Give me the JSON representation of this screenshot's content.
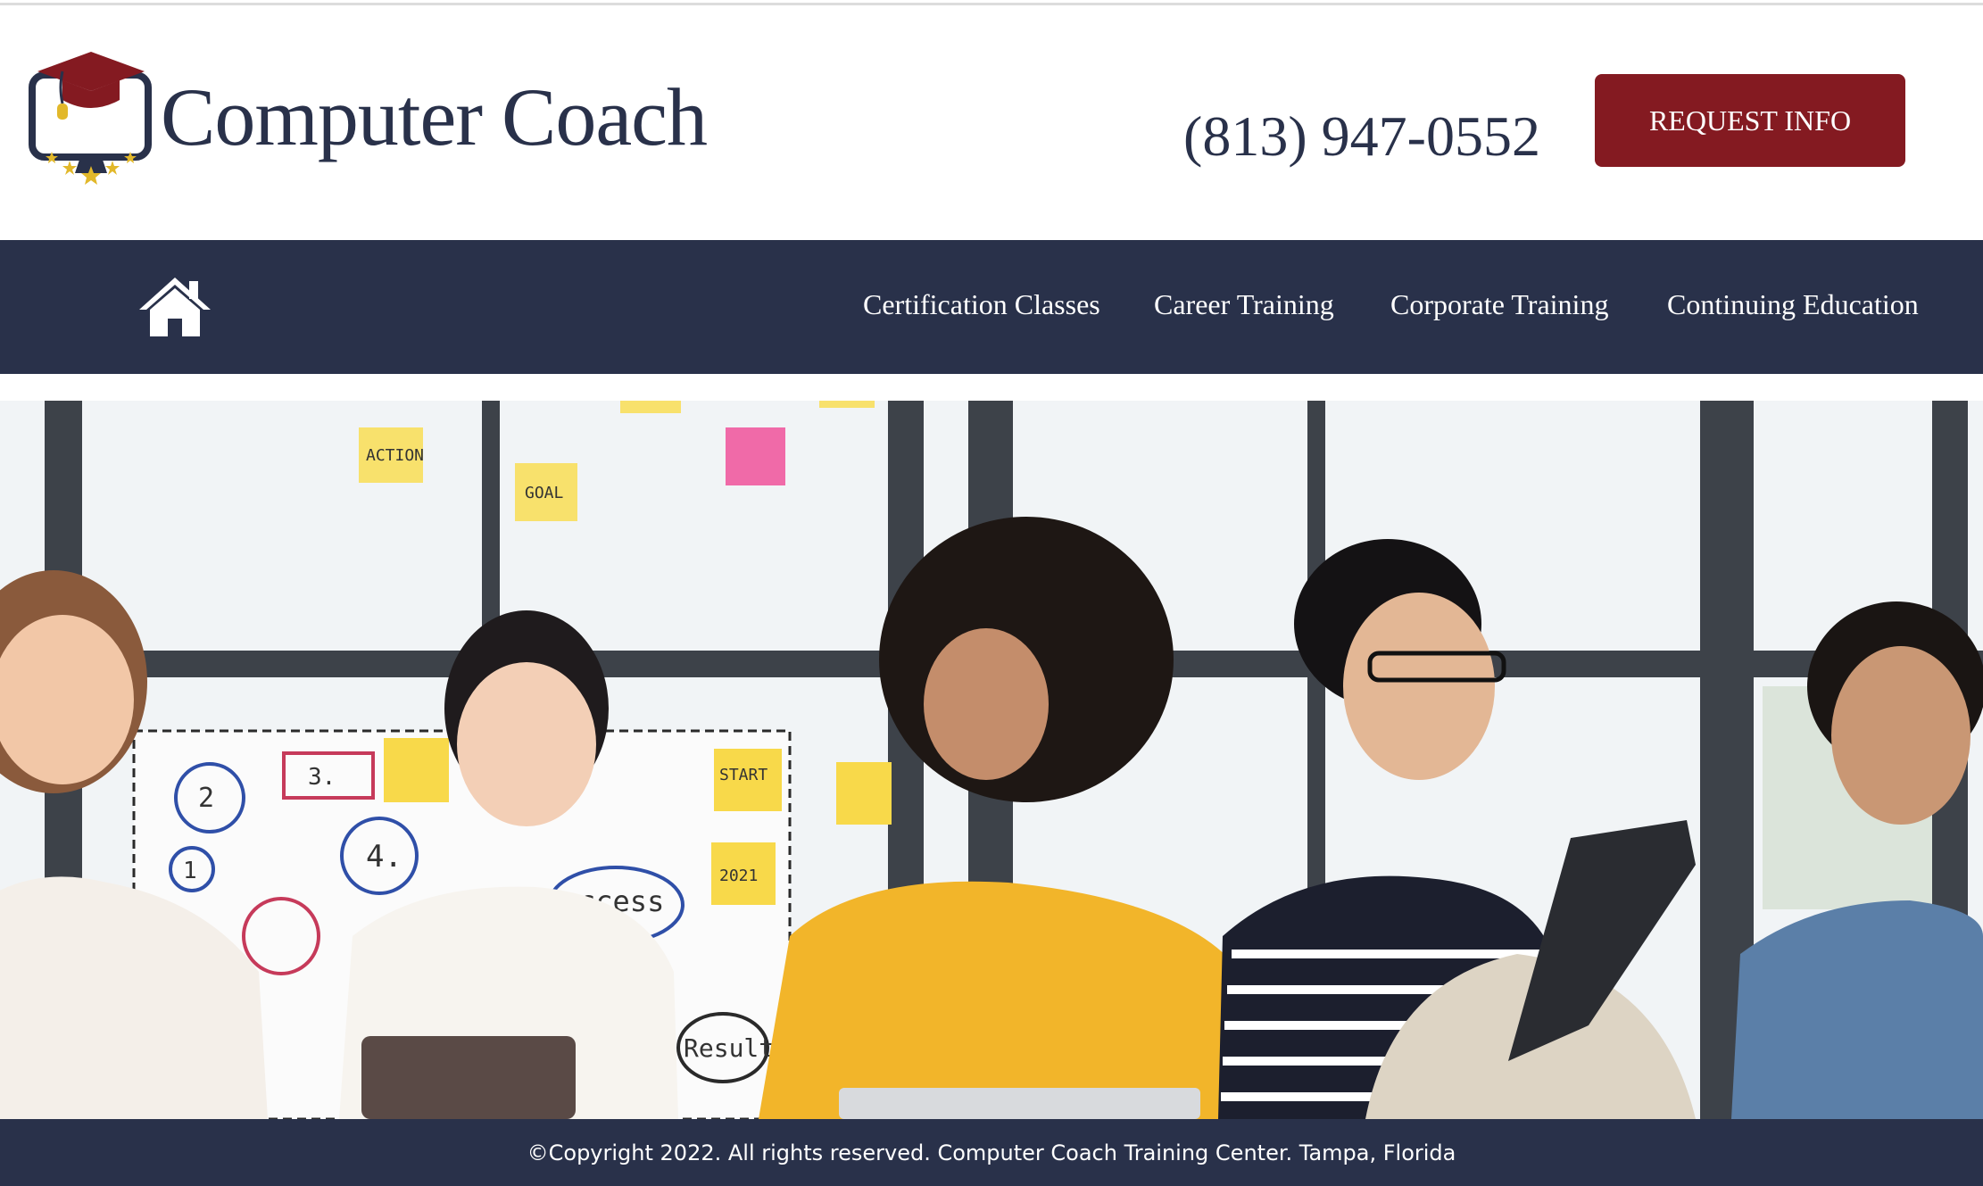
{
  "header": {
    "brand_name": "Computer Coach",
    "phone": "(813) 947-0552",
    "request_label": "REQUEST INFO"
  },
  "nav": {
    "home_icon": "home-icon",
    "items": [
      {
        "label": "Certification Classes"
      },
      {
        "label": "Career Training"
      },
      {
        "label": "Corporate Training"
      },
      {
        "label": "Continuing Education"
      }
    ]
  },
  "hero": {
    "notes": [
      "ACTION",
      "GOAL",
      "START",
      "2021",
      "3.",
      "2",
      "4.",
      "1",
      "ccess",
      "Result."
    ]
  },
  "footer": {
    "copyright": "©Copyright 2022. All rights reserved. Computer Coach Training Center. Tampa, Florida"
  },
  "colors": {
    "navy": "#29314a",
    "maroon": "#841a21",
    "gold": "#e2b82a"
  }
}
